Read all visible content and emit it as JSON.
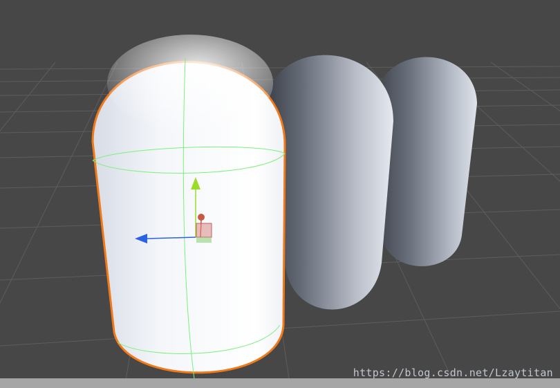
{
  "scene": {
    "background_color": "#474747",
    "grid_color": "#5c5c5c",
    "selection_outline_color": "#f07a1a",
    "collider_wire_color": "#7cf07a",
    "objects": [
      {
        "name": "capsule-selected",
        "selected": true
      },
      {
        "name": "capsule-middle",
        "selected": false
      },
      {
        "name": "capsule-back",
        "selected": false
      }
    ],
    "gizmo": {
      "y_axis_color": "#9bdc2a",
      "z_axis_color": "#2a62e6",
      "x_axis_color": "#d04a3a"
    }
  },
  "watermark": {
    "text": "https://blog.csdn.net/Lzaytitan"
  }
}
